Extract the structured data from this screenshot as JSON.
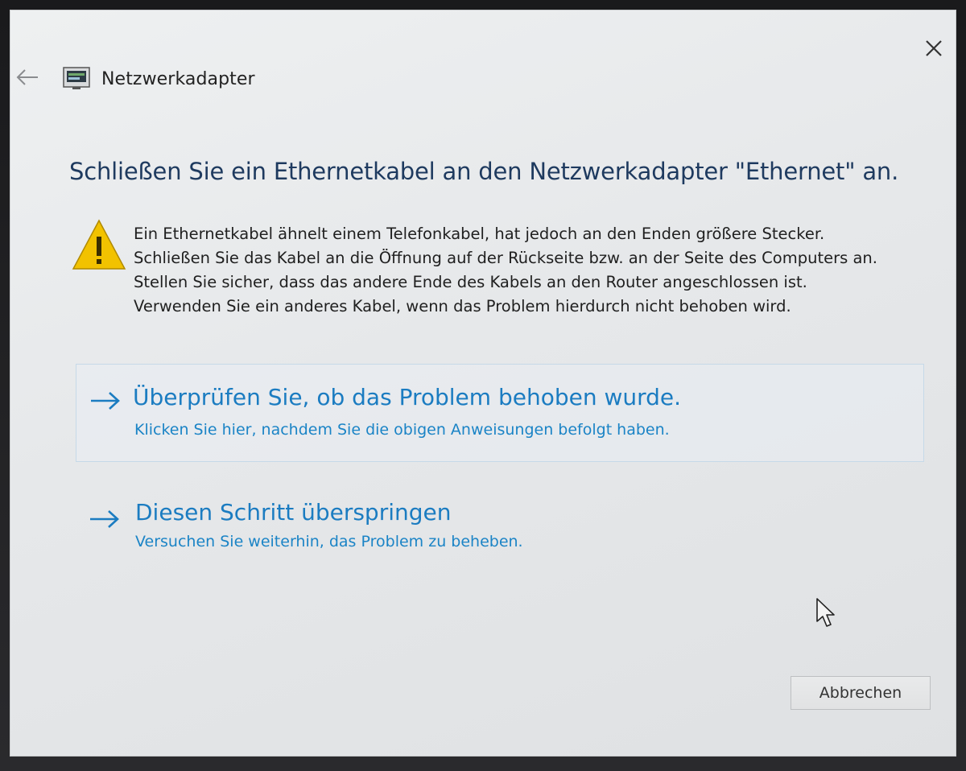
{
  "window": {
    "title": "Netzwerkadapter"
  },
  "icons": {
    "back": "arrow-left-icon",
    "close": "close-icon",
    "header": "network-adapter-icon",
    "warning": "warning-icon",
    "option_arrow": "arrow-right-icon",
    "cursor": "mouse-pointer-icon"
  },
  "colors": {
    "heading": "#1e3a5f",
    "link": "#1b7cc1",
    "warning": "#f2c200"
  },
  "main": {
    "heading": "Schließen Sie ein Ethernetkabel an den Netzwerkadapter \"Ethernet\" an.",
    "info_lines": [
      "Ein Ethernetkabel ähnelt einem Telefonkabel, hat jedoch an den Enden größere Stecker.",
      "Schließen Sie das Kabel an die Öffnung auf der Rückseite bzw. an der Seite des Computers an.",
      "Stellen Sie sicher, dass das andere Ende des Kabels an den Router angeschlossen ist.",
      "Verwenden Sie ein anderes Kabel, wenn das Problem hierdurch nicht behoben wird."
    ]
  },
  "options": [
    {
      "title": "Überprüfen Sie, ob das Problem behoben wurde.",
      "subtitle": "Klicken Sie hier, nachdem Sie die obigen Anweisungen befolgt haben."
    },
    {
      "title": "Diesen Schritt überspringen",
      "subtitle": "Versuchen Sie weiterhin, das Problem zu beheben."
    }
  ],
  "footer": {
    "cancel_label": "Abbrechen"
  }
}
